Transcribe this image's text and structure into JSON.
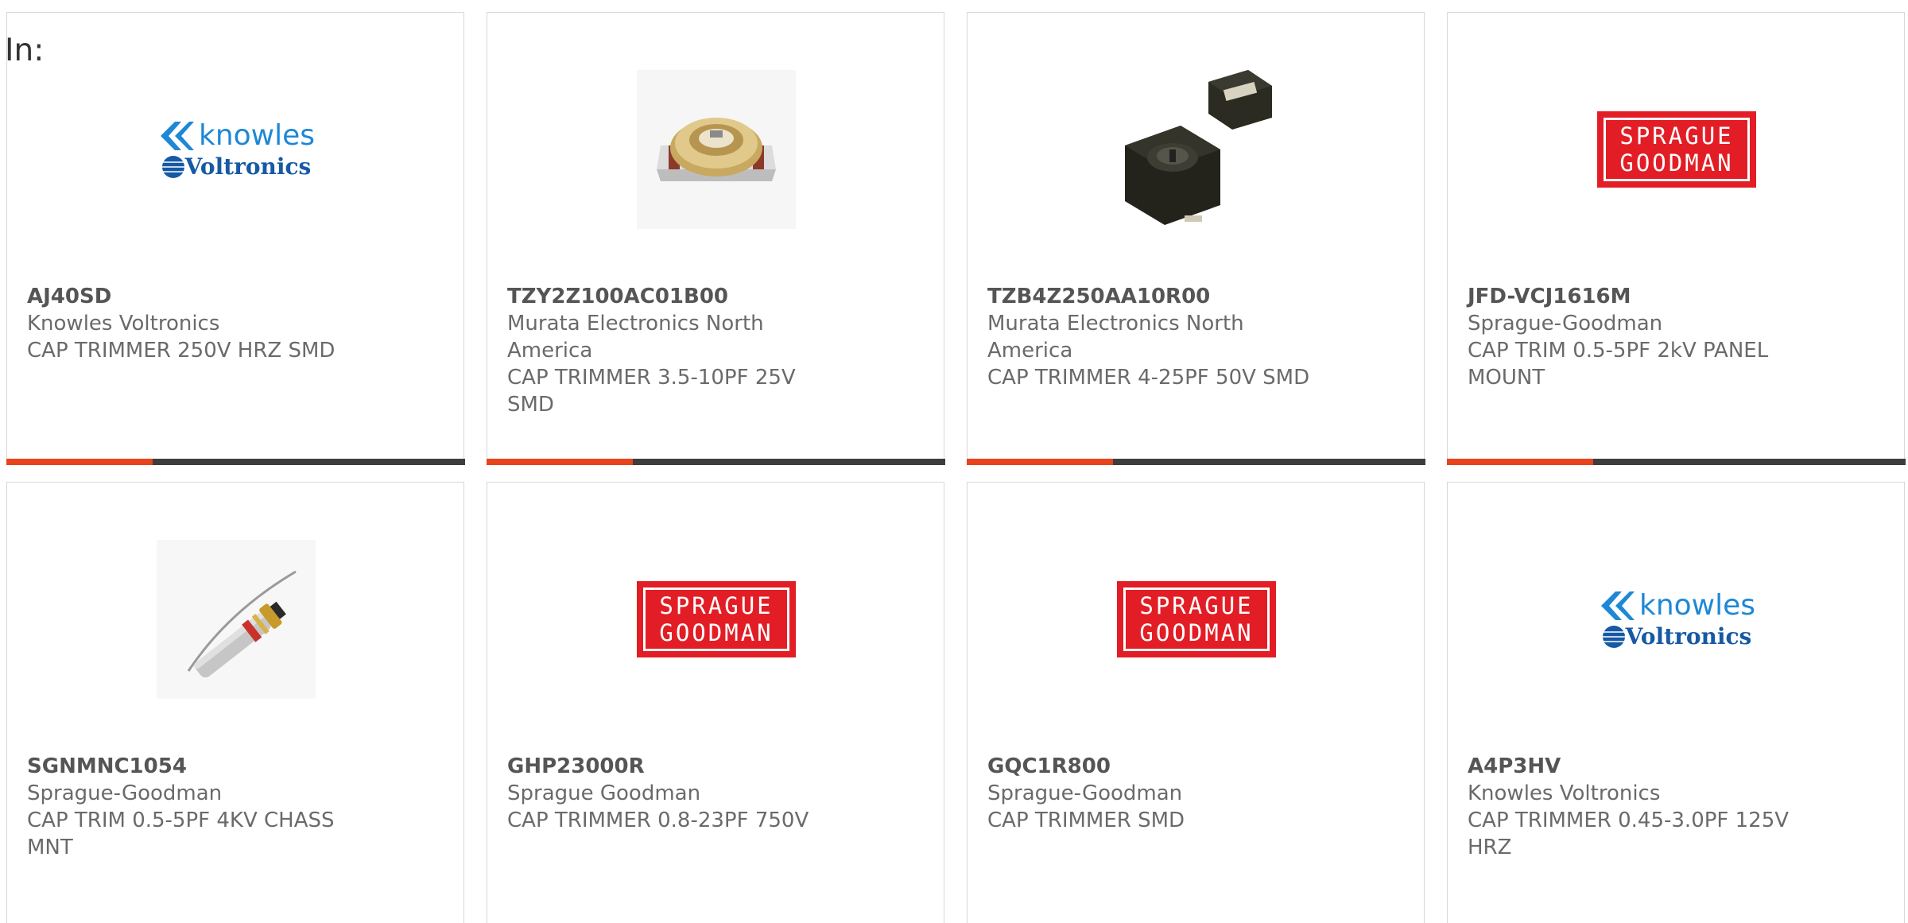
{
  "filter_label": "In:",
  "products": [
    {
      "part_number": "AJ40SD",
      "manufacturer": "Knowles Voltronics",
      "description": "CAP TRIMMER 250V HRZ SMD",
      "image": "knowles-voltronics-logo",
      "logo_lines": [
        "knowles",
        "Voltronics"
      ],
      "progress_fraction": 0.32
    },
    {
      "part_number": "TZY2Z100AC01B00",
      "manufacturer": "Murata Electronics North America",
      "description": "CAP TRIMMER 3.5-10PF 25V SMD",
      "image": "trimmer-capacitor-photo-gold",
      "progress_fraction": 0.32
    },
    {
      "part_number": "TZB4Z250AA10R00",
      "manufacturer": "Murata Electronics North America",
      "description": "CAP TRIMMER 4-25PF 50V SMD",
      "image": "trimmer-capacitor-photo-black",
      "progress_fraction": 0.32
    },
    {
      "part_number": "JFD-VCJ1616M",
      "manufacturer": "Sprague-Goodman",
      "description": "CAP TRIM 0.5-5PF 2kV PANEL MOUNT",
      "image": "sprague-goodman-logo",
      "logo_lines": [
        "SPRAGUE",
        "GOODMAN"
      ],
      "progress_fraction": 0.32
    },
    {
      "part_number": "SGNMNC1054",
      "manufacturer": "Sprague-Goodman",
      "description": "CAP TRIM 0.5-5PF 4KV CHASS MNT",
      "image": "piston-trimmer-photo",
      "progress_fraction": null
    },
    {
      "part_number": "GHP23000R",
      "manufacturer": "Sprague Goodman",
      "description": "CAP TRIMMER 0.8-23PF 750V",
      "image": "sprague-goodman-logo",
      "logo_lines": [
        "SPRAGUE",
        "GOODMAN"
      ],
      "progress_fraction": null
    },
    {
      "part_number": "GQC1R800",
      "manufacturer": "Sprague-Goodman",
      "description": "CAP TRIMMER SMD",
      "image": "sprague-goodman-logo",
      "logo_lines": [
        "SPRAGUE",
        "GOODMAN"
      ],
      "progress_fraction": null
    },
    {
      "part_number": "A4P3HV",
      "manufacturer": "Knowles Voltronics",
      "description": "CAP TRIMMER 0.45-3.0PF 125V HRZ",
      "image": "knowles-voltronics-logo",
      "logo_lines": [
        "knowles",
        "Voltronics"
      ],
      "progress_fraction": null
    }
  ],
  "colors": {
    "progress_fill": "#e8431c",
    "progress_track": "#3d3d3d",
    "sprague_red": "#e31d25",
    "knowles_blue": "#1e88d6",
    "voltronics_blue": "#1659a5",
    "text_gray": "#6a6a6a",
    "card_border": "#d8d8d8"
  }
}
